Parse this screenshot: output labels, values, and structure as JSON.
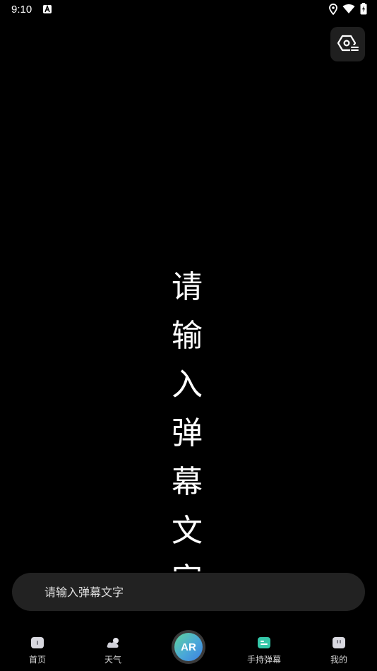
{
  "status_bar": {
    "time": "9:10",
    "notification_icon": "a-notification-icon",
    "icons": [
      "location-icon",
      "wifi-icon",
      "battery-charging-icon"
    ]
  },
  "settings_button": {
    "icon": "settings-icon"
  },
  "preview": {
    "characters": [
      "请",
      "输",
      "入",
      "弹",
      "幕",
      "文",
      "字"
    ]
  },
  "input": {
    "placeholder": "请输入弹幕文字",
    "value": ""
  },
  "tabs": [
    {
      "label": "首页",
      "icon": "home-icon",
      "active": false
    },
    {
      "label": "天气",
      "icon": "weather-icon",
      "active": false
    },
    {
      "label": "手持弹幕",
      "icon": "barrage-icon",
      "active": true
    },
    {
      "label": "我的",
      "icon": "profile-icon",
      "active": false
    }
  ],
  "ar_button": {
    "label": "AR"
  },
  "colors": {
    "background": "#000000",
    "accent": "#34c7a9",
    "input_bg": "#222222"
  }
}
